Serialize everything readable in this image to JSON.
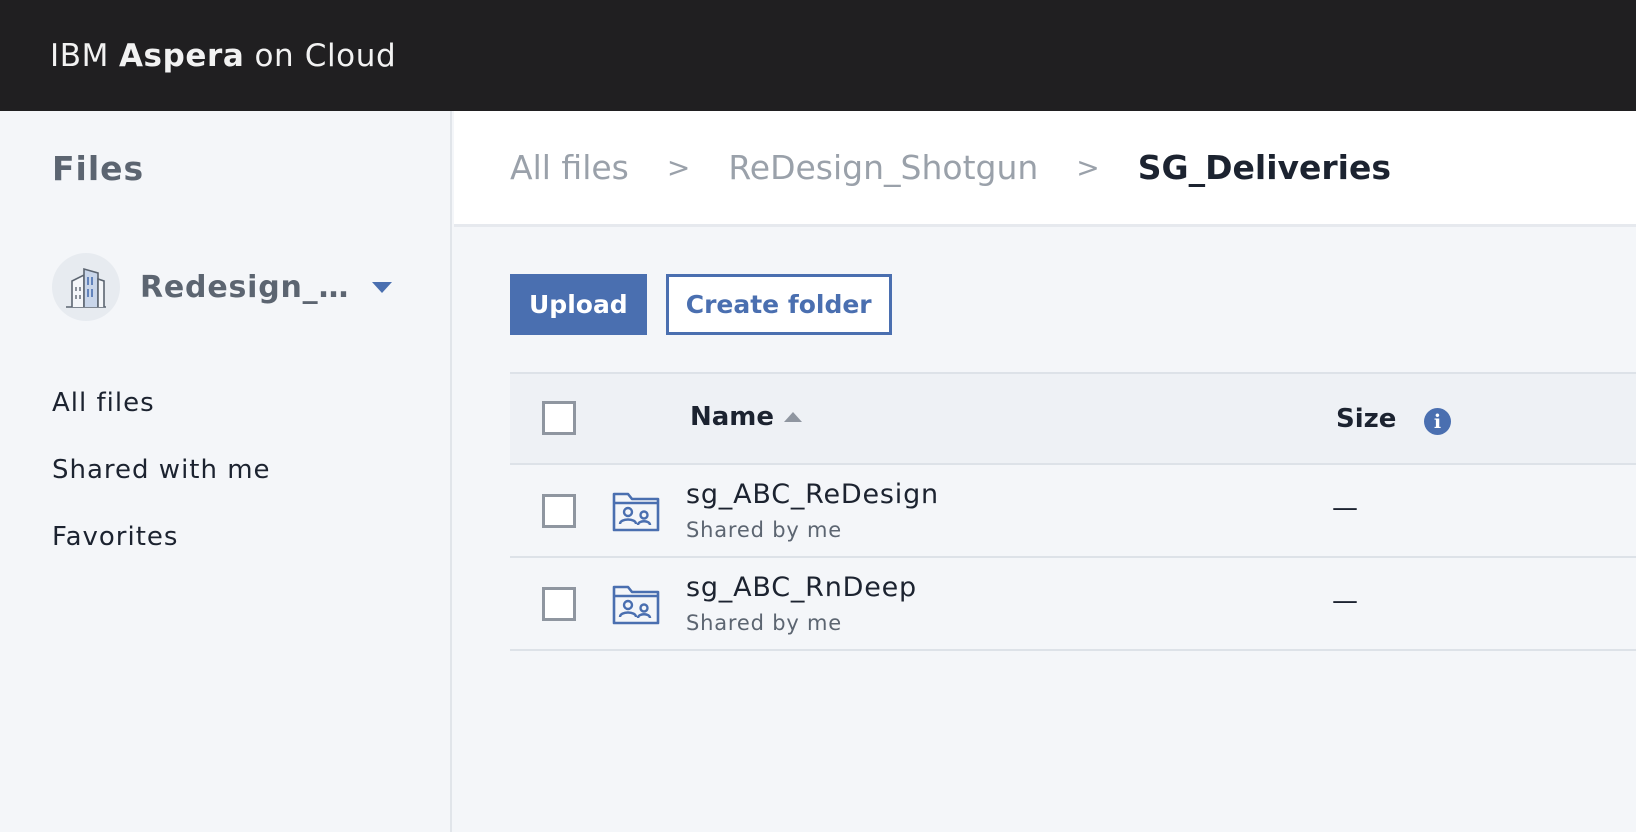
{
  "header": {
    "brand_prefix": "IBM",
    "brand_bold": "Aspera",
    "brand_suffix": "on Cloud"
  },
  "sidebar": {
    "title": "Files",
    "workspace": {
      "name": "Redesign_Sh..."
    },
    "items": [
      {
        "label": "All files"
      },
      {
        "label": "Shared with me"
      },
      {
        "label": "Favorites"
      }
    ]
  },
  "breadcrumb": {
    "items": [
      {
        "label": "All files"
      },
      {
        "label": "ReDesign_Shotgun"
      }
    ],
    "separator": ">",
    "current": "SG_Deliveries"
  },
  "toolbar": {
    "upload_label": "Upload",
    "create_folder_label": "Create folder"
  },
  "table": {
    "columns": {
      "name": "Name",
      "size": "Size",
      "info_glyph": "i"
    },
    "rows": [
      {
        "name": "sg_ABC_ReDesign",
        "subtitle": "Shared by me",
        "size": "—",
        "icon": "shared-folder-icon"
      },
      {
        "name": "sg_ABC_RnDeep",
        "subtitle": "Shared by me",
        "size": "—",
        "icon": "shared-folder-icon"
      }
    ]
  },
  "colors": {
    "topbar": "#201f21",
    "accent": "#4a6fb0",
    "background": "#f4f6f9"
  }
}
